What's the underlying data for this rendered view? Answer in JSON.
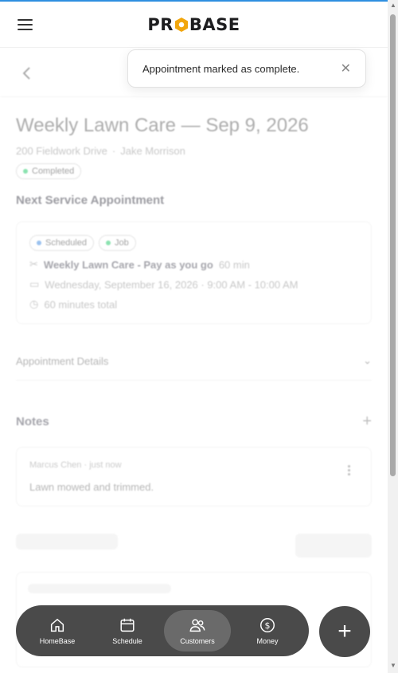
{
  "header": {
    "logo_left": "PR",
    "logo_right": "BASE"
  },
  "toast": {
    "message": "Appointment marked as complete.",
    "close_glyph": "✕"
  },
  "appointment": {
    "title": "Weekly Lawn Care — Sep 9, 2026",
    "address": "200 Fieldwork Drive",
    "separator": "·",
    "customer": "Jake Morrison",
    "status": "Completed",
    "status_color": "#2ecc71"
  },
  "next_service": {
    "section_title": "Next Service Appointment",
    "badges": [
      {
        "label": "Scheduled",
        "color": "#4a90e2"
      },
      {
        "label": "Job",
        "color": "#2ecc71"
      }
    ],
    "service_name": "Weekly Lawn Care - Pay as you go",
    "service_duration": "60 min",
    "date_time": "Wednesday, September 16, 2026 · 9:00 AM - 10:00 AM",
    "total": "60 minutes total"
  },
  "details": {
    "label": "Appointment Details"
  },
  "notes": {
    "title": "Notes",
    "items": [
      {
        "author": "Marcus Chen",
        "time": "just now",
        "text": "Lawn mowed and trimmed."
      }
    ]
  },
  "bottom_nav": {
    "items": [
      {
        "label": "HomeBase",
        "icon": "home-icon"
      },
      {
        "label": "Schedule",
        "icon": "calendar-icon"
      },
      {
        "label": "Customers",
        "icon": "users-icon",
        "active": true
      },
      {
        "label": "Money",
        "icon": "dollar-icon"
      }
    ],
    "fab_glyph": "+"
  }
}
